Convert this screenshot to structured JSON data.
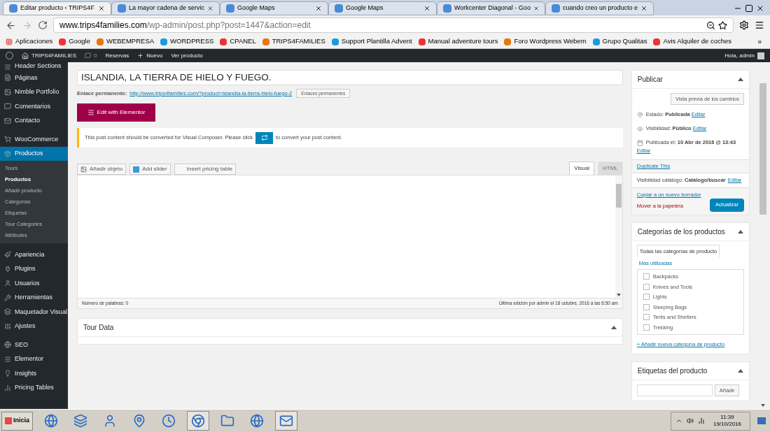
{
  "browser": {
    "tabs": [
      {
        "label": "Editar producto ‹ TRIPS4F",
        "selected": true
      },
      {
        "label": "La mayor cadena de servic",
        "selected": false
      },
      {
        "label": "Google Maps",
        "selected": false
      },
      {
        "label": "Google Maps",
        "selected": false
      },
      {
        "label": "Workcenter Diagonal - Goo",
        "selected": false
      },
      {
        "label": "cuando creo un producto e",
        "selected": false
      }
    ],
    "url_host": "www.trips4families.com",
    "url_path": "/wp-admin/post.php?post=1447&action=edit",
    "bookmarks": [
      "Aplicaciones",
      "Google",
      "WEBEMPRESA",
      "WORDPRESS",
      "CPANEL",
      "TRIPS4FAMILIES",
      "Support Plantilla Advent",
      "Manual adventure tours",
      "Foro Wordpress Webem",
      "Grupo Qualitas",
      "Avis Alquiler de coches"
    ],
    "bookmarks_more": "»"
  },
  "admin_bar": {
    "site": "TRIPS4FAMILIES",
    "comments": "0",
    "items": [
      "Reservas",
      "Nuevo",
      "Ver producto"
    ],
    "greeting": "Hola, admin"
  },
  "sidebar": {
    "groups": [
      [
        {
          "label": "Header Sections",
          "selected": false
        },
        {
          "label": "Páginas",
          "selected": false
        },
        {
          "label": "Nimble Portfolio",
          "selected": false
        },
        {
          "label": "Comentarios",
          "selected": false
        },
        {
          "label": "Contacto",
          "selected": false
        }
      ],
      [
        {
          "label": "WooCommerce",
          "selected": false
        },
        {
          "label": "Productos",
          "selected": true,
          "children": [
            {
              "label": "Tours",
              "selected": false
            },
            {
              "label": "Productos",
              "selected": true
            },
            {
              "label": "Añadir producto",
              "selected": false
            },
            {
              "label": "Categorías",
              "selected": false
            },
            {
              "label": "Etiquetas",
              "selected": false
            },
            {
              "label": "Tour Categories",
              "selected": false
            },
            {
              "label": "Attributes",
              "selected": false
            }
          ]
        }
      ],
      [
        {
          "label": "Apariencia",
          "selected": false
        },
        {
          "label": "Plugins",
          "selected": false
        },
        {
          "label": "Usuarios",
          "selected": false
        },
        {
          "label": "Herramientas",
          "selected": false
        },
        {
          "label": "Maquetador Visual",
          "selected": false
        },
        {
          "label": "Ajustes",
          "selected": false
        }
      ],
      [
        {
          "label": "SEO",
          "selected": false
        },
        {
          "label": "Elementor",
          "selected": false
        },
        {
          "label": "Insights",
          "selected": false
        },
        {
          "label": "Pricing Tables",
          "selected": false
        }
      ]
    ]
  },
  "editor": {
    "title": "ISLANDIA, LA TIERRA DE HIELO Y FUEGO.",
    "permalink_label": "Enlace permanente:",
    "permalink": "http://www.trips4families.com/?product=islandia-la-tierra-hielo-fuego-2",
    "permalink_button": "Enlaces permanentes",
    "elementor_button": "Edit with Elementor",
    "notice_before": "This post content should be converted for Visual Composer. Please click",
    "notice_after": "to convert your post content.",
    "media_buttons": [
      "Añadir objeto",
      "Add slider",
      "Insert pricing table"
    ],
    "mode_tabs": [
      {
        "label": "Visual",
        "selected": true
      },
      {
        "label": "HTML",
        "selected": false
      }
    ],
    "word_count": "Número de palabras: 0",
    "last_edit": "Última edición por admin el 18 octubre, 2016 a las 6:50 am",
    "metabox": "Tour Data"
  },
  "publish": {
    "title": "Publicar",
    "preview_button": "Vista previa de los cambios",
    "rows": [
      {
        "label": "Estado:",
        "value": "Publicada",
        "link": "Editar"
      },
      {
        "label": "Visibilidad:",
        "value": "Público",
        "link": "Editar"
      },
      {
        "label": "Publicada el:",
        "value": "10 Abr de 2016 @ 13:43",
        "link": "Editar"
      }
    ],
    "duplicate": "Duplicate This",
    "catalog_label": "Visibilidad catálogo:",
    "catalog_value": "Catálogo/buscar",
    "catalog_link": "Editar",
    "copy_link": "Copiar a un nuevo borrador",
    "trash_link": "Mover a la papelera",
    "update_button": "Actualizar"
  },
  "categories": {
    "title": "Categorías de los productos",
    "tabs": [
      {
        "label": "Todas las categorías de producto",
        "selected": true
      },
      {
        "label": "Más utilizadas",
        "selected": false
      }
    ],
    "items": [
      {
        "label": "Backpacks",
        "checked": false
      },
      {
        "label": "Knives and Tools",
        "checked": false
      },
      {
        "label": "Lights",
        "checked": false
      },
      {
        "label": "Sleeping Bags",
        "checked": false
      },
      {
        "label": "Tents and Shelters",
        "checked": false
      },
      {
        "label": "Trekking",
        "checked": false
      }
    ],
    "add_link": "+ Añadir nueva categoría de producto"
  },
  "tags": {
    "title": "Etiquetas del producto",
    "add_button": "Añadir"
  },
  "taskbar": {
    "start": "Inicia",
    "time": "11:39",
    "date": "19/10/2016"
  }
}
